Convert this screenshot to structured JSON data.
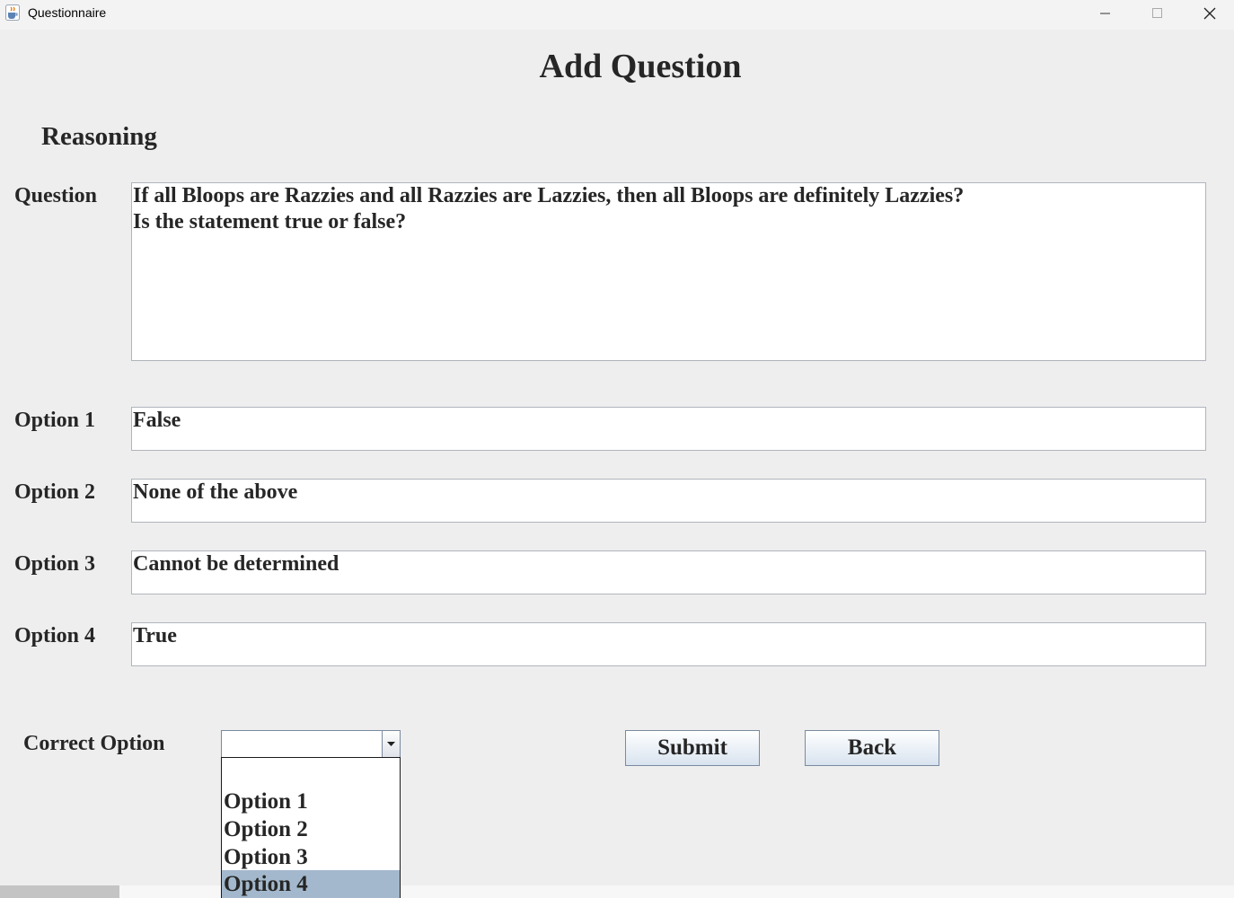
{
  "window": {
    "title": "Questionnaire",
    "icon": "java-cup-icon"
  },
  "header": {
    "title": "Add Question"
  },
  "category": "Reasoning",
  "question": {
    "label": "Question",
    "value": "If all Bloops are Razzies and all Razzies are Lazzies, then all Bloops are definitely Lazzies?\nIs the statement true or false?"
  },
  "options": [
    {
      "label": "Option 1",
      "value": "False"
    },
    {
      "label": "Option 2",
      "value": "None of the above"
    },
    {
      "label": "Option 3",
      "value": "Cannot be determined"
    },
    {
      "label": "Option 4",
      "value": "True"
    }
  ],
  "correct": {
    "label": "Correct Option",
    "selected": "",
    "dropdown_items": [
      "",
      "Option 1",
      "Option 2",
      "Option 3",
      "Option 4"
    ],
    "highlighted": "Option 4"
  },
  "buttons": {
    "submit": "Submit",
    "back": "Back"
  },
  "colors": {
    "window_bg": "#eeeeee",
    "highlight": "#a3b8cc",
    "text": "#262626"
  }
}
